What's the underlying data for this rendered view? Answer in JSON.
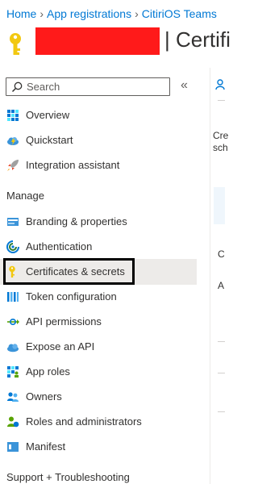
{
  "breadcrumb": {
    "home": "Home",
    "app_registrations": "App registrations",
    "tenant": "CitiriOS Teams"
  },
  "header": {
    "title": "| Certifi"
  },
  "search": {
    "placeholder": "Search",
    "collapse_glyph": "«"
  },
  "sidebar": {
    "items_top": [
      {
        "label": "Overview",
        "icon": "overview-grid-icon"
      },
      {
        "label": "Quickstart",
        "icon": "cloud-bolt-icon"
      },
      {
        "label": "Integration assistant",
        "icon": "rocket-icon"
      }
    ],
    "manage_heading": "Manage",
    "manage_items": [
      {
        "label": "Branding & properties",
        "icon": "branding-icon"
      },
      {
        "label": "Authentication",
        "icon": "authentication-icon"
      },
      {
        "label": "Certificates & secrets",
        "icon": "key-icon",
        "selected": true
      },
      {
        "label": "Token configuration",
        "icon": "token-bars-icon"
      },
      {
        "label": "API permissions",
        "icon": "api-permissions-icon"
      },
      {
        "label": "Expose an API",
        "icon": "cloud-icon"
      },
      {
        "label": "App roles",
        "icon": "app-roles-icon"
      },
      {
        "label": "Owners",
        "icon": "owners-icon"
      },
      {
        "label": "Roles and administrators",
        "icon": "roles-admins-icon"
      },
      {
        "label": "Manifest",
        "icon": "manifest-icon"
      }
    ],
    "support_heading": "Support + Troubleshooting"
  },
  "main": {
    "frag_cre": "Cre",
    "frag_sch": "sch",
    "frag_c": "C",
    "frag_a": "A"
  },
  "colors": {
    "link": "#0078d4",
    "selected_bg": "#edebe9",
    "redaction": "#ff1a1a",
    "key_gold": "#f2c811"
  }
}
